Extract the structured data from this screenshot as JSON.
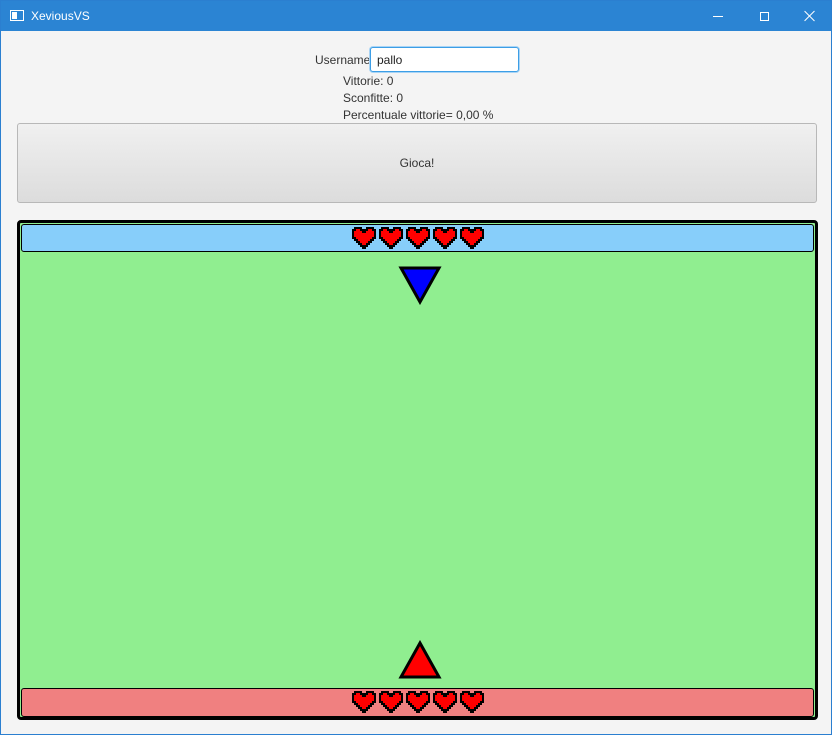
{
  "window": {
    "title": "XeviousVS",
    "controls": [
      "minimize",
      "maximize",
      "close"
    ]
  },
  "login": {
    "username_label": "Username",
    "username_value": "pallo"
  },
  "stats": {
    "wins": "Vittorie: 0",
    "losses": "Sconfitte: 0",
    "win_pct": "Percentuale vittorie= 0,00 %"
  },
  "play_button_label": "Gioca!",
  "game": {
    "colors": {
      "field": "#90ee90",
      "enemy_bar": "#87cefa",
      "player_bar": "#f08080",
      "enemy_ship": "#0000ff",
      "player_ship": "#ff0000",
      "heart": "#ff0000"
    },
    "enemy": {
      "lives": 5,
      "ship_icon": "triangle-down-icon"
    },
    "player": {
      "lives": 5,
      "ship_icon": "triangle-up-icon"
    }
  }
}
